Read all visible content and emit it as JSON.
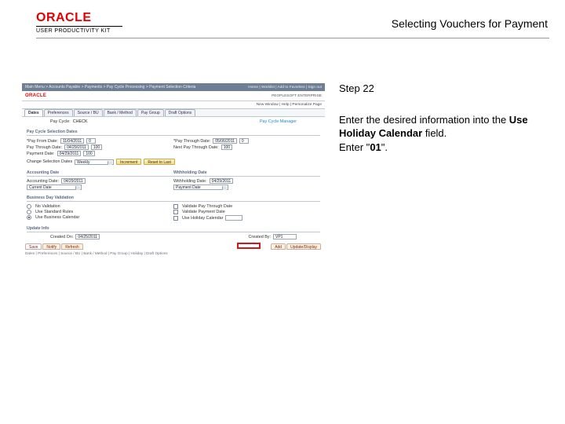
{
  "header": {
    "brand": "ORACLE",
    "subtitle": "USER PRODUCTIVITY KIT",
    "title": "Selecting Vouchers for Payment"
  },
  "panel": {
    "step": "Step 22",
    "line1_a": "Enter the desired information into the ",
    "line1_b": "Use Holiday Calendar",
    "line1_c": " field.",
    "line2_a": "Enter \"",
    "line2_b": "01",
    "line2_c": "\"."
  },
  "shot": {
    "topnav": "Main Menu  > Accounts Payable  >  Payments  >  Pay Cycle Processing  >  Payment Selection Criteria",
    "toplinks": "Home | Worklist | Add to Favorites | Sign out",
    "oracle": "ORACLE",
    "userline": "PEOPLESOFT ENTERPRISE",
    "window_line": "New Window | Help | Personalize Page",
    "tabs": [
      "Dates",
      "Preferences",
      "Source / BU",
      "Bank / Method",
      "Pay Group",
      "Draft Options"
    ],
    "paycycle_label": "Pay Cycle:",
    "paycycle_value": "CHECK",
    "mgr_label": "Pay Cycle Manager",
    "group_sel": "Pay Cycle Selection Dates",
    "pf_label": "*Pay From Date:",
    "pf_val": "11/04/2011",
    "pf_num": "0",
    "pt_label": "*Pay Through Date:",
    "pt_val": "05/06/2011",
    "pt_num": "0",
    "ptd_label": "Pay Through Date:",
    "ptd_val": "04/29/2011",
    "ptd_num": "100",
    "nps_label": "Next Pay Through Date:",
    "nps_num": "100",
    "chg_label": "Change Selection Dates",
    "chg_opt": "Weekly",
    "inc_btn": "Increment",
    "res_btn": "Reset to Last",
    "grp_acct": "Accounting Date",
    "grp_with": "Withholding Date",
    "ad_label": "Accounting Date:",
    "ad_val": "04/29/2011",
    "md_label": "Withholding Date:",
    "md_val": "04/29/2011",
    "opt_cur": "Current Date",
    "opt_pay": "Payment Date",
    "grp_bdv": "Business Day Validation",
    "r1": "No Validation",
    "r2": "Use Standard Rules",
    "r3": "Use Business Calendar",
    "c1": "Validate Pay Through Date",
    "c2": "Validate Payment Date",
    "c3": "Use Holiday Calendar",
    "grp_upd": "Update Info",
    "cr_label": "Created On:",
    "cr_val": "04/25/2011",
    "crby_label": "Created By:",
    "crby_val": "VP1",
    "save": "Save",
    "notify": "Notify",
    "refresh": "Refresh",
    "add": "Add",
    "updisp": "Update/Display",
    "bottom_links": "Dates | Preferences | Source / BU | Bank / Method | Pay Group | Holiday | Draft Options"
  }
}
